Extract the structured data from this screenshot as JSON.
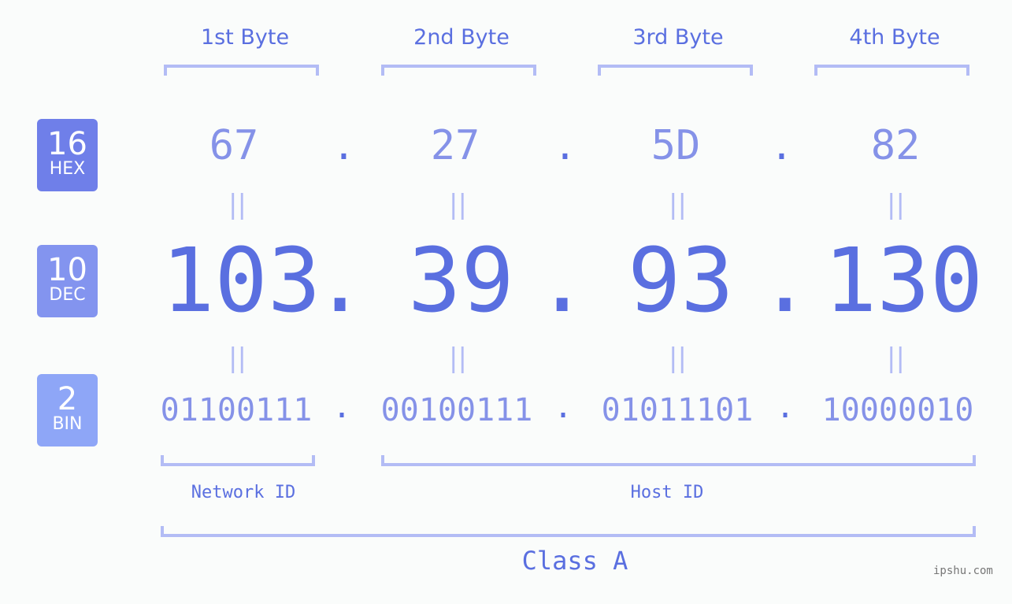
{
  "bytes": [
    {
      "label": "1st Byte",
      "hex": "67",
      "dec": "103",
      "bin": "01100111"
    },
    {
      "label": "2nd Byte",
      "hex": "27",
      "dec": "39",
      "bin": "00100111"
    },
    {
      "label": "3rd Byte",
      "hex": "5D",
      "dec": "93",
      "bin": "01011101"
    },
    {
      "label": "4th Byte",
      "hex": "82",
      "dec": "130",
      "bin": "10000010"
    }
  ],
  "separator": ".",
  "equals": "||",
  "badges": {
    "hex": {
      "num": "16",
      "text": "HEX",
      "color": "#6f7fe9"
    },
    "dec": {
      "num": "10",
      "text": "DEC",
      "color": "#8394ef"
    },
    "bin": {
      "num": "2",
      "text": "BIN",
      "color": "#8ea6f7"
    }
  },
  "segments": {
    "network": "Network ID",
    "host": "Host ID",
    "class": "Class A"
  },
  "watermark": "ipshu.com"
}
